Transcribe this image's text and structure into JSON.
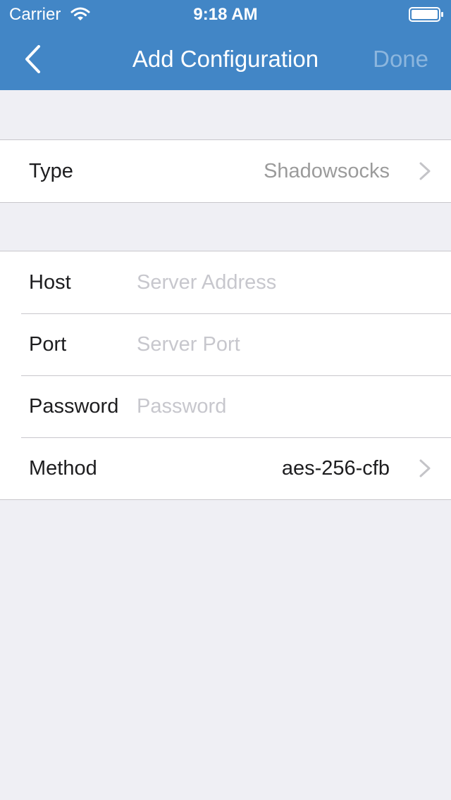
{
  "status_bar": {
    "carrier": "Carrier",
    "time": "9:18 AM",
    "icons": [
      "wifi-icon",
      "battery-icon"
    ]
  },
  "nav": {
    "back_icon": "chevron-left-icon",
    "title": "Add Configuration",
    "done_label": "Done"
  },
  "type_section": {
    "label": "Type",
    "value": "Shadowsocks",
    "accessory_icon": "chevron-right-icon"
  },
  "server_section": {
    "host": {
      "label": "Host",
      "value": "",
      "placeholder": "Server Address"
    },
    "port": {
      "label": "Port",
      "value": "",
      "placeholder": "Server Port"
    },
    "password": {
      "label": "Password",
      "value": "",
      "placeholder": "Password"
    },
    "method": {
      "label": "Method",
      "value": "aes-256-cfb",
      "accessory_icon": "chevron-right-icon"
    }
  },
  "colors": {
    "header_bg": "#4286c6",
    "page_bg": "#efeff4",
    "done_disabled": "#8cb6de",
    "placeholder": "#c7c7cd",
    "secondary_text": "#9b9b9b"
  }
}
